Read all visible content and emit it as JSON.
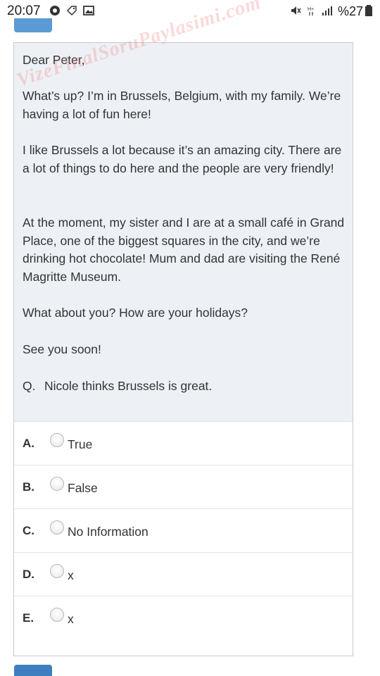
{
  "status_bar": {
    "time": "20:07",
    "battery": "%27",
    "icons": [
      "whatsapp-icon",
      "tag-icon",
      "image-icon",
      "mute-icon",
      "hplus-icon",
      "signal-icon",
      "battery-icon"
    ]
  },
  "passage": {
    "greeting": "Dear Peter,",
    "paragraphs": [
      "What’s up? I’m in Brussels, Belgium, with my family. We’re having a lot of fun here!",
      "I like Brussels a lot because it’s an amazing city. There are a lot of things to do here and the people are very friendly!",
      "At the moment, my sister and I are at a small café in Grand Place, one of the biggest squares in the city, and we’re drinking hot chocolate! Mum and dad are visiting the René Magritte Museum.",
      "What about you? How are your holidays?",
      "See you soon!"
    ]
  },
  "question": {
    "prefix": "Q.",
    "text": "Nicole thinks Brussels is great."
  },
  "options": [
    {
      "letter": "A.",
      "text": "True"
    },
    {
      "letter": "B.",
      "text": "False"
    },
    {
      "letter": "C.",
      "text": "No Information"
    },
    {
      "letter": "D.",
      "text": "x"
    },
    {
      "letter": "E.",
      "text": "x"
    }
  ],
  "watermark": "VizeFinalSoruPaylasimi.com",
  "colors": {
    "passage_bg": "#edf1f6",
    "button_blue": "#5b9bd5",
    "watermark": "#f07878"
  }
}
